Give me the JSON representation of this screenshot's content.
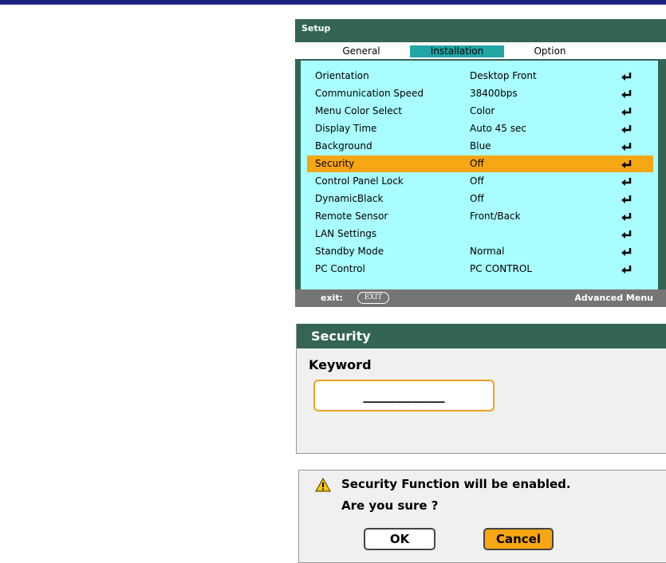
{
  "setup": {
    "title": "Setup",
    "tabs": [
      "General",
      "Installation",
      "Option"
    ],
    "active_tab": "Installation",
    "rows": [
      {
        "label": "Orientation",
        "value": "Desktop Front"
      },
      {
        "label": "Communication Speed",
        "value": "38400bps"
      },
      {
        "label": "Menu Color Select",
        "value": "Color"
      },
      {
        "label": "Display Time",
        "value": "Auto 45 sec"
      },
      {
        "label": "Background",
        "value": "Blue"
      },
      {
        "label": "Security",
        "value": "Off"
      },
      {
        "label": "Control Panel Lock",
        "value": "Off"
      },
      {
        "label": "DynamicBlack",
        "value": "Off"
      },
      {
        "label": "Remote Sensor",
        "value": "Front/Back"
      },
      {
        "label": "LAN Settings",
        "value": ""
      },
      {
        "label": "Standby Mode",
        "value": "Normal"
      },
      {
        "label": "PC Control",
        "value": "PC CONTROL"
      }
    ],
    "selected_row": "Security",
    "footer": {
      "exit_label": "exit:",
      "exit_key": "EXIT",
      "advanced": "Advanced Menu"
    }
  },
  "security": {
    "title": "Security",
    "keyword_label": "Keyword",
    "keyword_value": "__________"
  },
  "confirm": {
    "icon": "warning-icon",
    "message": "Security Function will be enabled.",
    "question": "Are you sure ?",
    "ok": "OK",
    "cancel": "Cancel"
  },
  "colors": {
    "menu_bg": "#346554",
    "panel": "#a9fdff",
    "highlight": "#f7a614",
    "tab_active": "#20a5a5"
  }
}
